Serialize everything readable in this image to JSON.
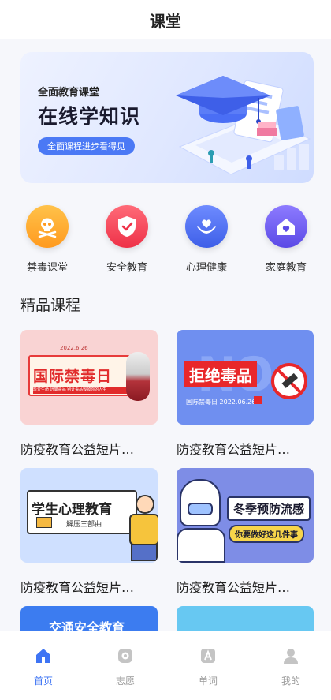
{
  "header": {
    "title": "课堂"
  },
  "banner": {
    "subtitle": "全面教育课堂",
    "title": "在线学知识",
    "button": "全面课程进步看得见"
  },
  "categories": [
    {
      "label": "禁毒课堂",
      "icon": "skull-icon",
      "color": "#ffa726"
    },
    {
      "label": "安全教育",
      "icon": "shield-check-icon",
      "color": "#f5465a"
    },
    {
      "label": "心理健康",
      "icon": "heart-hands-icon",
      "color": "#4a6ef5"
    },
    {
      "label": "家庭教育",
      "icon": "home-heart-icon",
      "color": "#6b5cf0"
    }
  ],
  "section": {
    "title": "精品课程"
  },
  "courses": [
    {
      "title": "防疫教育公益短片…",
      "thumb": {
        "heading": "国际禁毒日",
        "date": "2022.6.26",
        "tagline": "珍爱生命 远离毒品 别让毒品毁掉你的人生"
      }
    },
    {
      "title": "防疫教育公益短片…",
      "thumb": {
        "heading": "拒绝毒品",
        "bg_text": "NO",
        "date": "国际禁毒日 2022.06.26"
      }
    },
    {
      "title": "防疫教育公益短片…",
      "thumb": {
        "heading": "学生心理教育",
        "sub": "解压三部曲"
      }
    },
    {
      "title": "防疫教育公益短片…",
      "thumb": {
        "heading": "冬季预防流感",
        "sub": "你要做好这几件事"
      }
    },
    {
      "thumb": {
        "heading": "交通安全教育"
      }
    },
    {
      "thumb": {}
    }
  ],
  "tabs": [
    {
      "label": "首页",
      "icon": "home-icon",
      "active": true
    },
    {
      "label": "志愿",
      "icon": "volunteer-icon",
      "active": false
    },
    {
      "label": "单词",
      "icon": "word-a-icon",
      "active": false
    },
    {
      "label": "我的",
      "icon": "user-icon",
      "active": false
    }
  ],
  "colors": {
    "accent": "#3e74f4",
    "inactive": "#999999"
  }
}
